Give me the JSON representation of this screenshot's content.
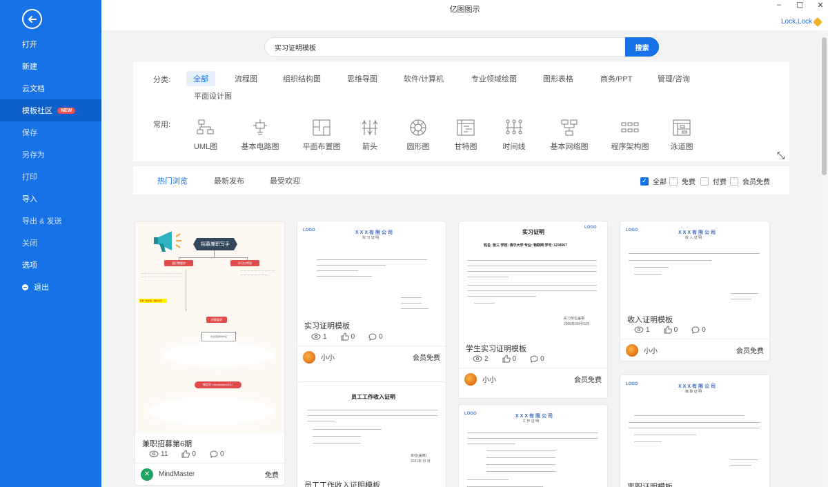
{
  "app": {
    "title": "亿图图示",
    "user": "Lock.Lock"
  },
  "sidebar": {
    "items": [
      {
        "label": "打开"
      },
      {
        "label": "新建"
      },
      {
        "label": "云文档"
      },
      {
        "label": "模板社区",
        "badge": "NEW"
      },
      {
        "label": "保存"
      },
      {
        "label": "另存为"
      },
      {
        "label": "打印"
      },
      {
        "label": "导入"
      },
      {
        "label": "导出 & 发送"
      },
      {
        "label": "关闭"
      },
      {
        "label": "选项"
      },
      {
        "label": "退出"
      }
    ]
  },
  "search": {
    "value": "实习证明模板",
    "button": "搜索"
  },
  "filters": {
    "category_label": "分类:",
    "categories": [
      "全部",
      "流程图",
      "组织结构图",
      "思维导图",
      "软件/计算机",
      "专业领域绘图",
      "图形表格",
      "商务/PPT",
      "管理/咨询",
      "平面设计图"
    ],
    "common_label": "常用:",
    "common": [
      "UML图",
      "基本电路图",
      "平面布置图",
      "箭头",
      "圆形图",
      "甘特图",
      "时间线",
      "基本网络图",
      "程序架构图",
      "泳道图"
    ]
  },
  "tabs": [
    "热门浏览",
    "最新发布",
    "最受欢迎"
  ],
  "price_filters": [
    "全部",
    "免费",
    "付费",
    "会员免费"
  ],
  "cards": [
    {
      "title": "兼职招募第6期",
      "views": "11",
      "likes": "0",
      "comments": "0",
      "author": "MindMaster",
      "price": "免费",
      "thumb": {
        "center": "招募兼职写手",
        "left_node": "我们需要你",
        "right_node": "你可以得到",
        "bottom_node": "招募要求",
        "footer": "微信号: mindmaster2017",
        "bottom_box": "欢迎投稿你的作品",
        "highlight": "不限一轮文笔、擅长文字"
      }
    },
    {
      "title": "实习证明模板",
      "views": "1",
      "likes": "0",
      "comments": "0",
      "author": "小小",
      "price": "会员免费",
      "thumb": {
        "logo": "LOGO",
        "company": "XXX有限公司",
        "doc": "实 习 证 明"
      }
    },
    {
      "title": "学生实习证明模板",
      "views": "2",
      "likes": "0",
      "comments": "0",
      "author": "小小",
      "price": "会员免费",
      "thumb": {
        "heading": "实习证明",
        "logo": "LOGO",
        "info": "姓名: 张三  学校: 清华大学  专业: 物联网  学号: 1234567",
        "sign": "实习单位盖章:",
        "date": "2000年09月01日"
      }
    },
    {
      "title": "收入证明模板",
      "views": "1",
      "likes": "0",
      "comments": "0",
      "author": "小小",
      "price": "会员免费",
      "thumb": {
        "logo": "LOGO",
        "company": "XXX有限公司",
        "doc": "收 入 证 明"
      }
    },
    {
      "title": "员工工作收入证明模板",
      "thumb": {
        "heading": "员工工作收入证明",
        "unit": "单位(盖章)",
        "date": "2021年 月 日"
      }
    },
    {
      "thumb": {
        "logo": "LOGO",
        "company": "XXX有限公司",
        "doc": "工 作 证 明"
      }
    },
    {
      "title": "离职证明模板",
      "thumb": {
        "logo": "LOGO",
        "company": "XXX有限公司",
        "doc": "离 职 证 明"
      }
    }
  ]
}
